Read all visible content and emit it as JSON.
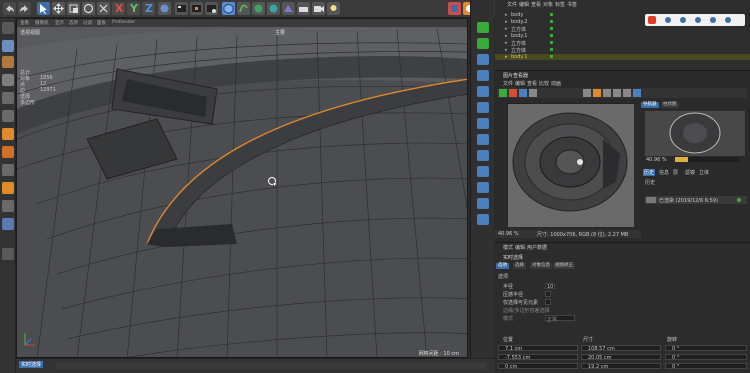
{
  "toolbar": {
    "axis_x": "X",
    "axis_y": "Y",
    "axis_z": "Z"
  },
  "viewport": {
    "menu_items": [
      "查看",
      "摄像机",
      "显示",
      "选项",
      "过滤",
      "面板",
      "ProRender"
    ],
    "camera_label": "透视视图",
    "camera_name": "主要",
    "stats": [
      {
        "label": "总计",
        "value": ""
      },
      {
        "label": "对象",
        "value": "1856"
      },
      {
        "label": "点",
        "value": "12"
      },
      {
        "label": "边",
        "value": "12971"
      },
      {
        "label": "选择",
        "value": ""
      },
      {
        "label": "多边形",
        "value": ""
      }
    ],
    "grid_spacing": "网格间距 : 10 cm",
    "bottom_label": "实时选择"
  },
  "object_manager": {
    "menu": [
      "文件",
      "编辑",
      "查看",
      "对象",
      "标签",
      "书签"
    ],
    "objects": [
      {
        "name": "body"
      },
      {
        "name": "body.2"
      },
      {
        "name": "立方体"
      },
      {
        "name": "body.1"
      },
      {
        "name": "立方体"
      },
      {
        "name": "立方体"
      },
      {
        "name": "body.1"
      }
    ]
  },
  "picture_viewer": {
    "title": "图片查看器",
    "menu": [
      "文件",
      "编辑",
      "查看",
      "比较",
      "动画"
    ],
    "tabs": [
      "导航器",
      "柱状图"
    ],
    "zoom": "40.96 %",
    "zoom_right": "40.96 %",
    "status": "尺寸: 1000x706, RGB (8 位), 2.27 MB",
    "history_tabs": [
      "历史",
      "信息",
      "层",
      "滤镜",
      "立体"
    ],
    "history_label": "历史",
    "render_item": "已渲染 (2019/12/6 6:59)"
  },
  "attributes": {
    "menu": [
      "模式",
      "编辑",
      "用户数据"
    ],
    "title": "实时选择",
    "tabs": [
      "选项",
      "选择",
      "对象信息",
      "视图矫正"
    ],
    "section": "选项",
    "fields": [
      {
        "label": "半径",
        "value": "10"
      },
      {
        "label": "压感半径",
        "value": ""
      },
      {
        "label": "仅选择可见元素",
        "value": ""
      },
      {
        "label": "边缘/多边形容差选择",
        "value": ""
      },
      {
        "label": "模式",
        "value": "正常"
      }
    ]
  },
  "coords": {
    "headers": [
      "位置",
      "尺寸",
      "旋转"
    ],
    "rows": [
      {
        "pos": "7.1 cm",
        "size": "108.57 cm",
        "rot": "0 °"
      },
      {
        "pos": "-7.553 cm",
        "size": "20.05 cm",
        "rot": "0 °"
      },
      {
        "pos": "0 cm",
        "size": "19.2 cm",
        "rot": "0 °"
      }
    ]
  },
  "colors": {
    "accent_orange": "#e08a2a",
    "select_blue": "#3c6ea8",
    "green": "#3aaa3a"
  }
}
